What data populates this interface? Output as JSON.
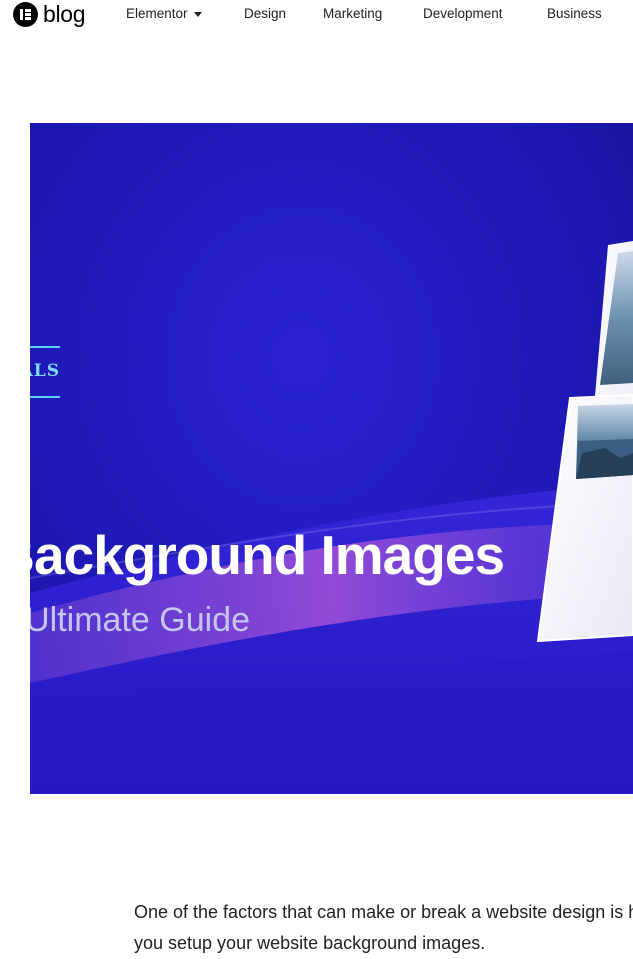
{
  "header": {
    "logo_text": "blog",
    "nav": [
      "Elementor",
      "Design",
      "Marketing",
      "Development",
      "Business"
    ]
  },
  "hero": {
    "category_label": "TUTORIALS",
    "title": "Background Images",
    "subtitle": "The Ultimate Guide",
    "colors": {
      "bg_dark": "#1a14a8",
      "bg_mid": "#2b1fd6",
      "wave": "#8a4fd6",
      "accent": "#5fd3f5"
    }
  },
  "article": {
    "intro_line1": "One of the factors that can make or break a website design is how",
    "intro_line2": "you setup your website background images."
  }
}
